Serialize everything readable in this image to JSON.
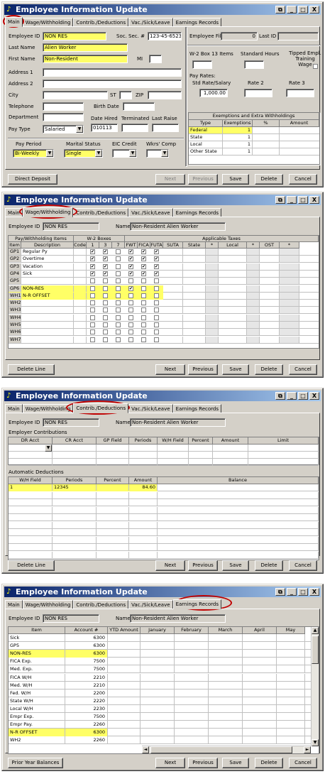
{
  "colors": {
    "title_start": "#0a246a",
    "title_end": "#a6caf0",
    "highlight": "#ffff66",
    "annotation": "#c00000"
  },
  "title": "Employee Information Update",
  "title_buttons": [
    "⧉",
    "_",
    "□",
    "X"
  ],
  "tabs": [
    "Main",
    "Wage/Withholding",
    "Contrib./Deductions",
    "Vac./Sick/Leave",
    "Earnings Records"
  ],
  "main": {
    "employee_id_label": "Employee ID",
    "employee_id": "NON RES",
    "ssn_label": "Soc. Sec. #",
    "ssn": "123-45-6523",
    "last_name_label": "Last Name",
    "last_name": "Alien Worker",
    "first_name_label": "First Name",
    "first_name": "Non-Resident",
    "mi_label": "MI",
    "address1_label": "Address 1",
    "address2_label": "Address 2",
    "city_label": "City",
    "st_label": "ST",
    "zip_label": "ZIP",
    "telephone_label": "Telephone",
    "birth_date_label": "Birth Date",
    "department_label": "Department",
    "date_hired_label": "Date Hired",
    "date_hired": "010113",
    "terminated_label": "Terminated",
    "last_raise_label": "Last Raise",
    "pay_type_label": "Pay Type",
    "pay_type": "Salaried",
    "pay_period_label": "Pay Period",
    "pay_period": "Bi-Weekly",
    "marital_status_label": "Marital Status",
    "marital_status": "Single",
    "eic_credit_label": "EIC Credit",
    "wkrs_comp_label": "Wkrs' Comp",
    "employee_files_label": "Employee Files",
    "employee_files_count": "0",
    "last_id_label": "Last ID",
    "w2_box13_label": "W-2 Box 13 Items",
    "standard_hours_label": "Standard Hours",
    "tipped_label": "Tipped Empl. Training Wage",
    "pay_rates_label": "Pay Rates:",
    "std_rate_label": "Std Rate/Salary",
    "std_rate": "1,000.00",
    "rate2_label": "Rate 2",
    "rate3_label": "Rate 3",
    "exemptions_title": "Exemptions and Extra Withholdings",
    "exemptions_headers": [
      "Type",
      "Exemptions",
      "%",
      "Amount"
    ],
    "exemptions_rows": [
      {
        "type": "Federal",
        "exemptions": "1"
      },
      {
        "type": "State",
        "exemptions": "1"
      },
      {
        "type": "Local",
        "exemptions": "1"
      },
      {
        "type": "Other State",
        "exemptions": "1"
      }
    ],
    "buttons": {
      "direct_deposit": "Direct Deposit",
      "next": "Next",
      "previous": "Previous",
      "save": "Save",
      "delete": "Delete",
      "cancel": "Cancel"
    }
  },
  "wage": {
    "employee_id_label": "Employee ID",
    "employee_id": "NON RES",
    "name_label": "Name",
    "name": "Non-Resident Alien Worker",
    "group1": "Pay/Withholding Items",
    "group2": "W-2 Boxes",
    "group3": "Applicable Taxes",
    "headers": [
      "Item",
      "Description",
      "Code",
      "1",
      "3",
      "7",
      "FWT",
      "FICA",
      "FUTA",
      "SUTA",
      "State",
      "*",
      "Local",
      "*",
      "OST",
      "*"
    ],
    "rows": [
      {
        "item": "GP1",
        "desc": "Regular Py",
        "w2": [
          true,
          true,
          false
        ],
        "tax": [
          true,
          true,
          true
        ]
      },
      {
        "item": "GP2",
        "desc": "Overtime",
        "w2": [
          true,
          true,
          false
        ],
        "tax": [
          true,
          true,
          true
        ]
      },
      {
        "item": "GP3",
        "desc": "Vacation",
        "w2": [
          true,
          true,
          false
        ],
        "tax": [
          true,
          true,
          true
        ]
      },
      {
        "item": "GP4",
        "desc": "Sick",
        "w2": [
          true,
          true,
          false
        ],
        "tax": [
          true,
          true,
          true
        ]
      },
      {
        "item": "GP5",
        "desc": "",
        "w2": [
          false,
          false,
          false
        ],
        "tax": [
          false,
          false,
          false
        ]
      },
      {
        "item": "GP6",
        "desc": "NON-RES",
        "w2": [
          false,
          false,
          false
        ],
        "tax": [
          true,
          false,
          false
        ]
      },
      {
        "item": "WH1",
        "desc": "N-R OFFSET",
        "w2": [
          false,
          false,
          false
        ],
        "tax": [
          false,
          false,
          false
        ]
      },
      {
        "item": "WH2",
        "desc": "",
        "w2": [
          false,
          false,
          false
        ],
        "tax": [
          false,
          false,
          false
        ]
      },
      {
        "item": "WH3",
        "desc": "",
        "w2": [
          false,
          false,
          false
        ],
        "tax": [
          false,
          false,
          false
        ]
      },
      {
        "item": "WH4",
        "desc": "",
        "w2": [
          false,
          false,
          false
        ],
        "tax": [
          false,
          false,
          false
        ]
      },
      {
        "item": "WH5",
        "desc": "",
        "w2": [
          false,
          false,
          false
        ],
        "tax": [
          false,
          false,
          false
        ]
      },
      {
        "item": "WH6",
        "desc": "",
        "w2": [
          false,
          false,
          false
        ],
        "tax": [
          false,
          false,
          false
        ]
      },
      {
        "item": "WH7",
        "desc": "",
        "w2": [
          false,
          false,
          false
        ],
        "tax": [
          false,
          false,
          false
        ]
      }
    ],
    "buttons": {
      "delete_line": "Delete Line",
      "next": "Next",
      "previous": "Previous",
      "save": "Save",
      "delete": "Delete",
      "cancel": "Cancel"
    }
  },
  "contrib": {
    "employee_id_label": "Employee ID",
    "employee_id": "NON RES",
    "name_label": "Name",
    "name": "Non-Resident Alien Worker",
    "employer_label": "Employer Contributions",
    "employer_headers": [
      "DR Acct",
      "CR Acct",
      "GP Field",
      "Periods",
      "W/H Field",
      "Percent",
      "Amount",
      "Limit"
    ],
    "auto_label": "Automatic Deductions",
    "auto_headers": [
      "W/H Field",
      "Periods",
      "Percent",
      "Amount",
      "Balance"
    ],
    "auto_row": {
      "wh_field": "1",
      "periods": "12345",
      "percent": "",
      "amount": "84.60",
      "balance": ""
    },
    "buttons": {
      "delete_line": "Delete Line",
      "next": "Next",
      "previous": "Previous",
      "save": "Save",
      "delete": "Delete",
      "cancel": "Cancel"
    }
  },
  "earnings": {
    "employee_id_label": "Employee ID",
    "employee_id": "NON RES",
    "name_label": "Name",
    "name": "Non-Resident Alien Worker",
    "headers": [
      "Item",
      "Account #",
      "YTD Amount",
      "January",
      "February",
      "March",
      "April",
      "May"
    ],
    "rows": [
      {
        "item": "Sick",
        "acct": "6300"
      },
      {
        "item": "GP5",
        "acct": "6300"
      },
      {
        "item": "NON-RES",
        "acct": "6300"
      },
      {
        "item": "FICA Exp.",
        "acct": "7500"
      },
      {
        "item": "Med. Exp.",
        "acct": "7500"
      },
      {
        "item": "FICA W/H",
        "acct": "2210"
      },
      {
        "item": "Med. W/H",
        "acct": "2210"
      },
      {
        "item": "Fed. W/H",
        "acct": "2200"
      },
      {
        "item": "State W/H",
        "acct": "2220"
      },
      {
        "item": "Local W/H",
        "acct": "2230"
      },
      {
        "item": "Empr Exp.",
        "acct": "7500"
      },
      {
        "item": "Empr Pay.",
        "acct": "2260"
      },
      {
        "item": "N-R OFFSET",
        "acct": "6300"
      },
      {
        "item": "WH2",
        "acct": "2260"
      }
    ],
    "buttons": {
      "prior_year": "Prior Year Balances",
      "next": "Next",
      "previous": "Previous",
      "save": "Save",
      "delete": "Delete",
      "cancel": "Cancel"
    }
  }
}
